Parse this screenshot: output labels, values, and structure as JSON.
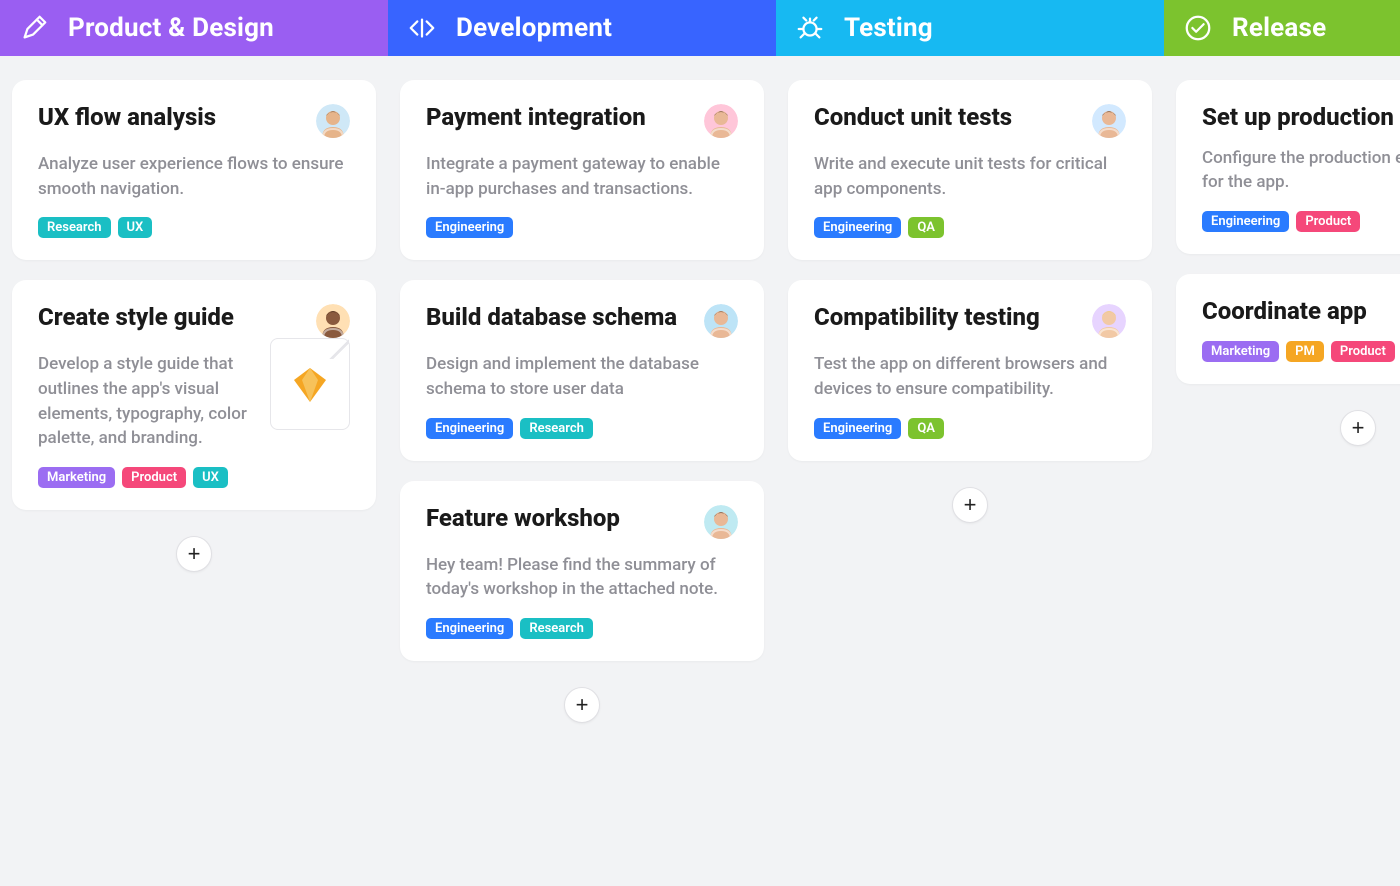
{
  "tag_colors": {
    "Research": "#1abfc4",
    "UX": "#1abfc4",
    "Marketing": "#9b6df2",
    "Product": "#f5487a",
    "Engineering": "#2a7bff",
    "QA": "#7cc32e",
    "PM": "#f5a623"
  },
  "avatar_palette": {
    "a1": {
      "bg": "#cfe8f7",
      "skin": "#e6b48a",
      "hair": "#6b4a2e"
    },
    "a2": {
      "bg": "#ffc6d9",
      "skin": "#e9b896",
      "hair": "#4a3220"
    },
    "a3": {
      "bg": "#d2e9ff",
      "skin": "#e9b896",
      "hair": "#3a2a1a"
    },
    "a4": {
      "bg": "#ffe0b4",
      "skin": "#8a5a3e",
      "hair": "#2e1d12"
    },
    "a5": {
      "bg": "#bde4f7",
      "skin": "#e9b896",
      "hair": "#5a3b22"
    },
    "a6": {
      "bg": "#e7d4ff",
      "skin": "#f2c9a5",
      "hair": "#e9cf6a"
    },
    "a7": {
      "bg": "#bfeaf2",
      "skin": "#e9b896",
      "hair": "#2e1e14"
    }
  },
  "columns": [
    {
      "id": "product-design",
      "title": "Product & Design",
      "header_color": "#9a5ef2",
      "icon": "pen",
      "cards": [
        {
          "title": "UX flow analysis",
          "desc": "Analyze user experience flows to ensure smooth navigation.",
          "avatar": "a1",
          "tags": [
            "Research",
            "UX"
          ],
          "attachment": null
        },
        {
          "title": "Create style guide",
          "desc": "Develop a style guide that outlines the app's visual elements, typography, color palette, and branding.",
          "avatar": "a4",
          "tags": [
            "Marketing",
            "Product",
            "UX"
          ],
          "attachment": "sketch"
        }
      ]
    },
    {
      "id": "development",
      "title": "Development",
      "header_color": "#3864ff",
      "icon": "code",
      "cards": [
        {
          "title": "Payment integration",
          "desc": "Integrate a payment gateway to enable in-app purchases and transactions.",
          "avatar": "a2",
          "tags": [
            "Engineering"
          ],
          "attachment": null
        },
        {
          "title": "Build database schema",
          "desc": "Design and implement the database schema to store user data",
          "avatar": "a5",
          "tags": [
            "Engineering",
            "Research"
          ],
          "attachment": null
        },
        {
          "title": "Feature workshop",
          "desc": "Hey team! Please find the summary of today's workshop in the attached note.",
          "avatar": "a7",
          "tags": [
            "Engineering",
            "Research"
          ],
          "attachment": null
        }
      ]
    },
    {
      "id": "testing",
      "title": "Testing",
      "header_color": "#17b9f2",
      "icon": "bug",
      "cards": [
        {
          "title": "Conduct unit tests",
          "desc": "Write and execute unit tests for critical app components.",
          "avatar": "a3",
          "tags": [
            "Engineering",
            "QA"
          ],
          "attachment": null
        },
        {
          "title": "Compatibility testing",
          "desc": "Test the app on different browsers and devices to ensure compatibility.",
          "avatar": "a6",
          "tags": [
            "Engineering",
            "QA"
          ],
          "attachment": null
        }
      ]
    },
    {
      "id": "release",
      "title": "Release",
      "header_color": "#7cc32e",
      "icon": "check",
      "cards": [
        {
          "title": "Set up production",
          "desc": "Configure the production environment for the app.",
          "avatar": null,
          "tags": [
            "Engineering",
            "Product"
          ],
          "attachment": null
        },
        {
          "title": "Coordinate app",
          "desc": "",
          "avatar": null,
          "tags": [
            "Marketing",
            "PM",
            "Product"
          ],
          "attachment": null
        }
      ]
    }
  ],
  "ui": {
    "add_card_label": "+"
  }
}
